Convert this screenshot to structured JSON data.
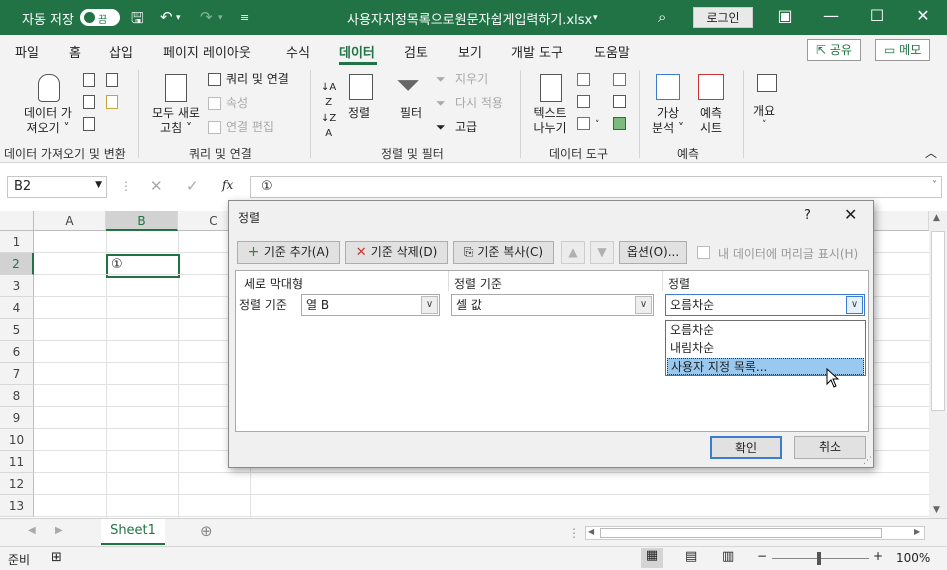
{
  "titlebar": {
    "autosave_label": "자동 저장",
    "autosave_state": "끔",
    "filename": "사용자지정목록으로원문자쉽게입력하기.xlsx",
    "login_label": "로그인"
  },
  "tabs": [
    "파일",
    "홈",
    "삽입",
    "페이지 레이아웃",
    "수식",
    "데이터",
    "검토",
    "보기",
    "개발 도구",
    "도움말"
  ],
  "active_tab": "데이터",
  "share_label": "공유",
  "memo_label": "메모",
  "ribbon": {
    "get_data": "데이터 가\n져오기 ˅",
    "refresh_all": "모두 새로\n고침 ˅",
    "queries": "쿼리 및 연결",
    "properties": "속성",
    "edit_links": "연결 편집",
    "sort": "정렬",
    "filter": "필터",
    "clear": "지우기",
    "reapply": "다시 적용",
    "advanced": "고급",
    "text_to_columns": "텍스트\n나누기",
    "whatif": "가상\n분석 ˅",
    "forecast": "예측\n시트",
    "outline": "개요",
    "groups": [
      "데이터 가져오기 및 변환",
      "쿼리 및 연결",
      "정렬 및 필터",
      "데이터 도구",
      "예측"
    ]
  },
  "formula_bar": {
    "namebox": "B2",
    "content": "①"
  },
  "columns": [
    "A",
    "B",
    "C"
  ],
  "rows": [
    "1",
    "2",
    "3",
    "4",
    "5",
    "6",
    "7",
    "8",
    "9",
    "10",
    "11",
    "12",
    "13"
  ],
  "cell_b2": "①",
  "sheet_tab": "Sheet1",
  "status": {
    "ready": "준비",
    "zoom": "100%"
  },
  "dialog": {
    "title": "정렬",
    "help": "?",
    "add_level": "기준 추가(A)",
    "delete_level": "기준 삭제(D)",
    "copy_level": "기준 복사(C)",
    "options": "옵션(O)...",
    "my_data_has_headers": "내 데이터에 머리글 표시(H)",
    "headers": {
      "column": "세로 막대형",
      "sort_on": "정렬 기준",
      "order": "정렬"
    },
    "row_label": "정렬 기준",
    "column_value": "열 B",
    "sort_on_value": "셀 값",
    "order_value": "오름차순",
    "order_options": [
      "오름차순",
      "내림차순",
      "사용자 지정 목록..."
    ],
    "ok": "확인",
    "cancel": "취소"
  }
}
